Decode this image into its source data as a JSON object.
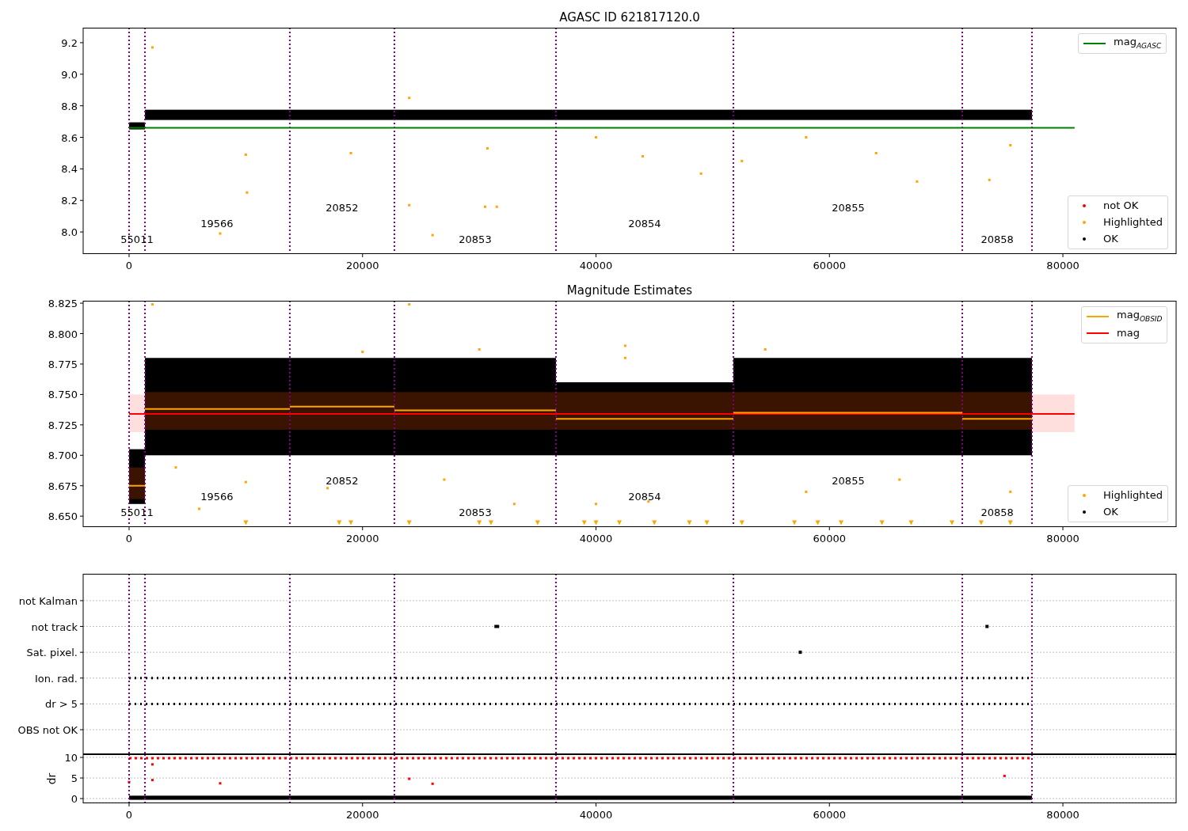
{
  "panels": [
    {
      "kind": "agasc",
      "legends": [
        [
          {
            "label": "not OK",
            "kind": "dot",
            "color": "#ff0000"
          },
          {
            "label": "Highlighted",
            "kind": "dot",
            "color": "#ffa500"
          },
          {
            "label": "OK",
            "kind": "dot",
            "color": "#000000"
          }
        ]
      ],
      "chart_data": {
        "type": "scatter",
        "title": "AGASC ID 621817120.0",
        "xlim": [
          -3935,
          89700
        ],
        "ylim": [
          7.86,
          9.295
        ],
        "xticks": [
          {
            "value": 0,
            "label": "0"
          },
          {
            "value": 20000,
            "label": "20000"
          },
          {
            "value": 40000,
            "label": "40000"
          },
          {
            "value": 60000,
            "label": "60000"
          },
          {
            "value": 80000,
            "label": "80000"
          }
        ],
        "yticks": [
          {
            "value": 9.2,
            "label": "9.2"
          },
          {
            "value": 9.0,
            "label": "9.0"
          },
          {
            "value": 8.8,
            "label": "8.8"
          },
          {
            "value": 8.6,
            "label": "8.6"
          },
          {
            "value": 8.4,
            "label": "8.4"
          },
          {
            "value": 8.2,
            "label": "8.2"
          },
          {
            "value": 8.0,
            "label": "8.0"
          }
        ],
        "ref_lines": [
          {
            "axis": "y",
            "value": 8.66,
            "label": "mag$_{AGASC}$",
            "color": "#008000"
          }
        ],
        "annotations": [
          "55011",
          "19566",
          "20852",
          "20853",
          "20854",
          "20855",
          "20858"
        ]
      }
    },
    {
      "kind": "obsid",
      "legends": [
        [
          {
            "label": "Highlighted",
            "kind": "dot",
            "color": "#ffa500"
          },
          {
            "label": "OK",
            "kind": "dot",
            "color": "#000000"
          }
        ]
      ],
      "chart_data": {
        "type": "line",
        "title": "Magnitude Estimates",
        "x": [
          0,
          1360,
          1360,
          13770,
          13770,
          22730,
          22730,
          36570,
          36570,
          51770,
          51770,
          71380,
          71380,
          77350
        ],
        "xlim": [
          -3935,
          89700
        ],
        "ylim": [
          8.641,
          8.827
        ],
        "xticks": [
          {
            "value": 0,
            "label": "0"
          },
          {
            "value": 20000,
            "label": "20000"
          },
          {
            "value": 40000,
            "label": "40000"
          },
          {
            "value": 60000,
            "label": "60000"
          },
          {
            "value": 80000,
            "label": "80000"
          }
        ],
        "yticks": [
          {
            "value": 8.825,
            "label": "8.825"
          },
          {
            "value": 8.8,
            "label": "8.800"
          },
          {
            "value": 8.775,
            "label": "8.775"
          },
          {
            "value": 8.75,
            "label": "8.750"
          },
          {
            "value": 8.725,
            "label": "8.725"
          },
          {
            "value": 8.7,
            "label": "8.700"
          },
          {
            "value": 8.675,
            "label": "8.675"
          },
          {
            "value": 8.65,
            "label": "8.650"
          }
        ],
        "series": [
          {
            "name": "mag$_{OBSID}$",
            "color": "#ffa500",
            "values": [
              8.675,
              8.675,
              8.738,
              8.738,
              8.74,
              8.74,
              8.737,
              8.737,
              8.73,
              8.73,
              8.735,
              8.735,
              8.73,
              8.73
            ]
          }
        ],
        "ref_lines": [
          {
            "axis": "y",
            "value": 8.734,
            "label": "mag",
            "color": "#ff0000"
          }
        ],
        "annotations": [
          "55011",
          "19566",
          "20852",
          "20853",
          "20854",
          "20855",
          "20858"
        ]
      }
    },
    {
      "kind": "flags",
      "chart_data": {
        "type": "scatter",
        "orientation": "horizontal",
        "grid": true,
        "xlim": [
          -3935,
          89700
        ],
        "categories": [
          "not Kalman",
          "not track",
          "Sat. pixel.",
          "Ion. rad.",
          "dr > 5",
          "OBS not OK"
        ]
      }
    },
    {
      "kind": "dr",
      "chart_data": {
        "type": "scatter",
        "ylabel": "dr",
        "grid": true,
        "xlim": [
          -3935,
          89700
        ],
        "ylim": [
          -1.15,
          10.77
        ],
        "xticks": [
          {
            "value": 0,
            "label": "0"
          },
          {
            "value": 20000,
            "label": "20000"
          },
          {
            "value": 40000,
            "label": "40000"
          },
          {
            "value": 60000,
            "label": "60000"
          },
          {
            "value": 80000,
            "label": "80000"
          }
        ],
        "yticks": [
          {
            "value": 10,
            "label": "10"
          },
          {
            "value": 5,
            "label": "5"
          },
          {
            "value": 0,
            "label": "0"
          }
        ]
      }
    }
  ]
}
